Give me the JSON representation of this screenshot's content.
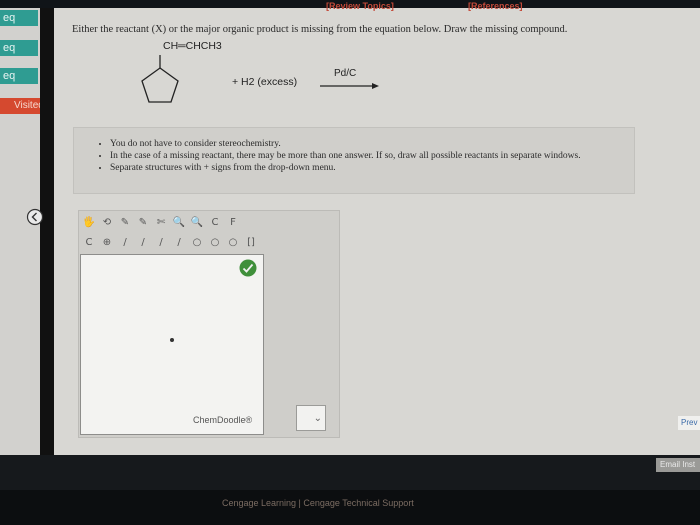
{
  "header": {
    "review_topics": "[Review Topics]",
    "references": "[References]"
  },
  "sidebar": {
    "tabs": [
      "eq",
      "eq",
      "eq"
    ],
    "visited": "Visited"
  },
  "question": {
    "text": "Either the reactant (X) or the major organic product is missing from the equation below. Draw the missing compound."
  },
  "equation": {
    "substituent": "CH═CHCH3",
    "reagent": "+ H2 (excess)",
    "catalyst": "Pd/C"
  },
  "instructions": [
    "You do not have to consider stereochemistry.",
    "In the case of a missing reactant, there may be more than one answer. If so, draw all possible reactants in separate windows.",
    "Separate structures with + signs from the drop-down menu."
  ],
  "editor": {
    "brand": "ChemDoodle®",
    "tools_row1": [
      "🖐",
      "⟲",
      "✎",
      "✎",
      "✄",
      "🔍",
      "🔍",
      "C",
      "F"
    ],
    "tools_row2": [
      "C",
      "⊕",
      "/",
      "/",
      "/",
      "/",
      "○",
      "○",
      "○",
      "[]"
    ]
  },
  "navigation": {
    "prev": "Prev",
    "email": "Email Inst"
  },
  "footer": {
    "text": "Cengage Learning | Cengage Technical Support"
  },
  "colors": {
    "teal": "#2f9c92",
    "visited": "#d5492f",
    "link": "#c34a3a"
  }
}
